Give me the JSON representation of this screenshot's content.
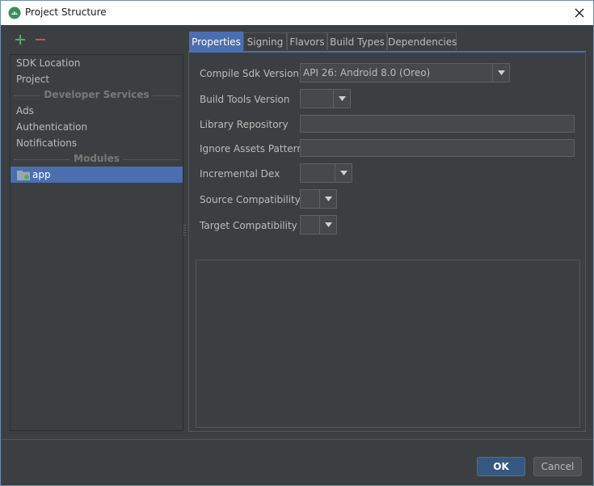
{
  "window": {
    "title": "Project Structure"
  },
  "toolbar": {
    "add_icon": "plus-icon",
    "remove_icon": "minus-icon"
  },
  "sidebar": {
    "items": [
      {
        "label": "SDK Location"
      },
      {
        "label": "Project"
      }
    ],
    "developer_services_header": "Developer Services",
    "services": [
      {
        "label": "Ads"
      },
      {
        "label": "Authentication"
      },
      {
        "label": "Notifications"
      }
    ],
    "modules_header": "Modules",
    "modules": [
      {
        "label": "app",
        "selected": true
      }
    ]
  },
  "tabs": [
    {
      "label": "Properties",
      "active": true
    },
    {
      "label": "Signing"
    },
    {
      "label": "Flavors"
    },
    {
      "label": "Build Types"
    },
    {
      "label": "Dependencies"
    }
  ],
  "form": {
    "compile_sdk_label": "Compile Sdk Version",
    "compile_sdk_value": "API 26: Android 8.0 (Oreo)",
    "build_tools_label": "Build Tools Version",
    "build_tools_value": "",
    "library_repo_label": "Library Repository",
    "library_repo_value": "",
    "ignore_assets_label": "Ignore Assets Pattern",
    "ignore_assets_value": "",
    "incremental_dex_label": "Incremental Dex",
    "incremental_dex_value": "",
    "source_compat_label": "Source Compatibility",
    "source_compat_value": "",
    "target_compat_label": "Target Compatibility",
    "target_compat_value": ""
  },
  "footer": {
    "ok_label": "OK",
    "cancel_label": "Cancel"
  },
  "colors": {
    "background": "#3c3f41",
    "selection": "#4b6eaf",
    "add_green": "#59a869",
    "remove_red": "#c75450",
    "text": "#bbbbbb"
  }
}
